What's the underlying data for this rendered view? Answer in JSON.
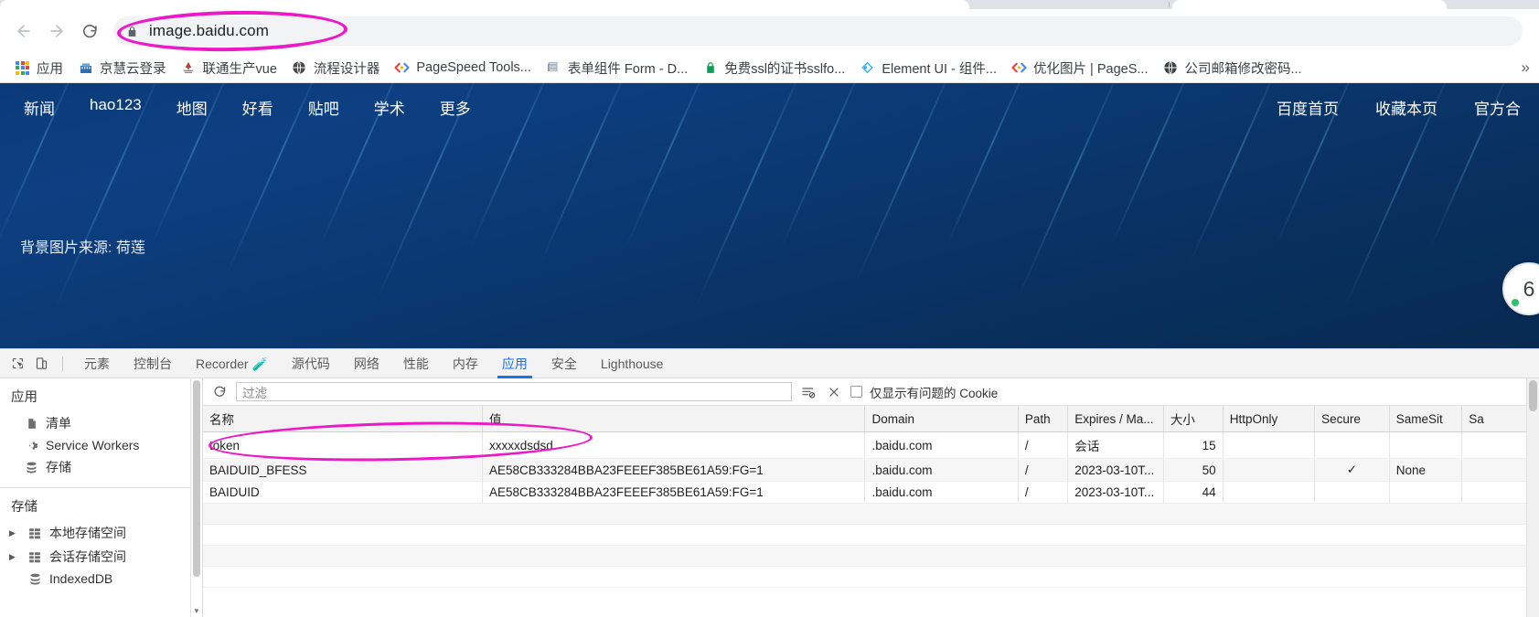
{
  "browser": {
    "nav": {
      "back": "back-arrow",
      "forward": "forward-arrow",
      "reload": "reload"
    },
    "omnibox": {
      "url": "image.baidu.com",
      "lock": "lock-icon"
    },
    "bookmarks": [
      {
        "label": "应用",
        "icon": "apps-grid-icon"
      },
      {
        "label": "京慧云登录",
        "icon": "building-icon"
      },
      {
        "label": "联通生产vue",
        "icon": "vue-icon"
      },
      {
        "label": "流程设计器",
        "icon": "globe-icon"
      },
      {
        "label": "PageSpeed Tools...",
        "icon": "code-icon"
      },
      {
        "label": "表单组件 Form - D...",
        "icon": "book-icon"
      },
      {
        "label": "免费ssl的证书sslfo...",
        "icon": "lock-green-icon"
      },
      {
        "label": "Element UI - 组件...",
        "icon": "element-icon"
      },
      {
        "label": "优化图片 | PageS...",
        "icon": "code-icon"
      },
      {
        "label": "公司邮箱修改密码...",
        "icon": "globe-dark-icon"
      }
    ],
    "bookmarks_overflow": "»"
  },
  "page": {
    "nav_left": [
      "新闻",
      "hao123",
      "地图",
      "好看",
      "贴吧",
      "学术",
      "更多"
    ],
    "nav_right": [
      "百度首页",
      "收藏本页",
      "官方合"
    ],
    "source_line": "背景图片来源: 荷莲",
    "fab": {
      "glyph": "6",
      "status": "online-dot"
    }
  },
  "devtools": {
    "toolbar_icons": [
      "inspect-element-icon",
      "device-toolbar-icon"
    ],
    "tabs": [
      {
        "label": "元素",
        "active": false
      },
      {
        "label": "控制台",
        "active": false
      },
      {
        "label": "Recorder 🧪",
        "active": false
      },
      {
        "label": "源代码",
        "active": false
      },
      {
        "label": "网络",
        "active": false
      },
      {
        "label": "性能",
        "active": false
      },
      {
        "label": "内存",
        "active": false
      },
      {
        "label": "应用",
        "active": true
      },
      {
        "label": "安全",
        "active": false
      },
      {
        "label": "Lighthouse",
        "active": false
      }
    ],
    "sidebar": {
      "section_app": "应用",
      "app_items": [
        {
          "label": "清单",
          "icon": "manifest-file-icon"
        },
        {
          "label": "Service Workers",
          "icon": "gear-icon"
        },
        {
          "label": "存储",
          "icon": "database-icon"
        }
      ],
      "section_storage": "存储",
      "storage_items": [
        {
          "label": "本地存储空间",
          "icon": "table-grid-icon",
          "expandable": true
        },
        {
          "label": "会话存储空间",
          "icon": "table-grid-icon",
          "expandable": true
        },
        {
          "label": "IndexedDB",
          "icon": "database-icon",
          "expandable": true
        }
      ]
    },
    "filterbar": {
      "refresh_icon": "refresh-icon",
      "placeholder": "过滤",
      "clear_filters_icon": "clear-filters-icon",
      "clear_icon": "close-x-icon",
      "checkbox_label": "仅显示有问题的 Cookie",
      "checkbox_checked": false
    },
    "table": {
      "columns": [
        "名称",
        "值",
        "Domain",
        "Path",
        "Expires / Ma...",
        "大小",
        "HttpOnly",
        "Secure",
        "SameSit",
        "Sa"
      ],
      "rows": [
        {
          "name": "token",
          "value": "xxxxxdsdsd",
          "domain": ".baidu.com",
          "path": "/",
          "expires": "会话",
          "size": "15",
          "httponly": "",
          "secure": "",
          "samesite": "",
          "sa": ""
        },
        {
          "name": "BAIDUID_BFESS",
          "value": "AE58CB333284BBA23FEEEF385BE61A59:FG=1",
          "domain": ".baidu.com",
          "path": "/",
          "expires": "2023-03-10T...",
          "size": "50",
          "httponly": "",
          "secure": "✓",
          "samesite": "None",
          "sa": ""
        },
        {
          "name": "BAIDUID",
          "value": "AE58CB333284BBA23FEEEF385BE61A59:FG=1",
          "domain": ".baidu.com",
          "path": "/",
          "expires": "2023-03-10T...",
          "size": "44",
          "httponly": "",
          "secure": "",
          "samesite": "",
          "sa": ""
        }
      ]
    }
  },
  "annotations": {
    "accent_color": "#ed18c8",
    "url_highlight": "image.baidu.com",
    "row_highlight": "token"
  }
}
